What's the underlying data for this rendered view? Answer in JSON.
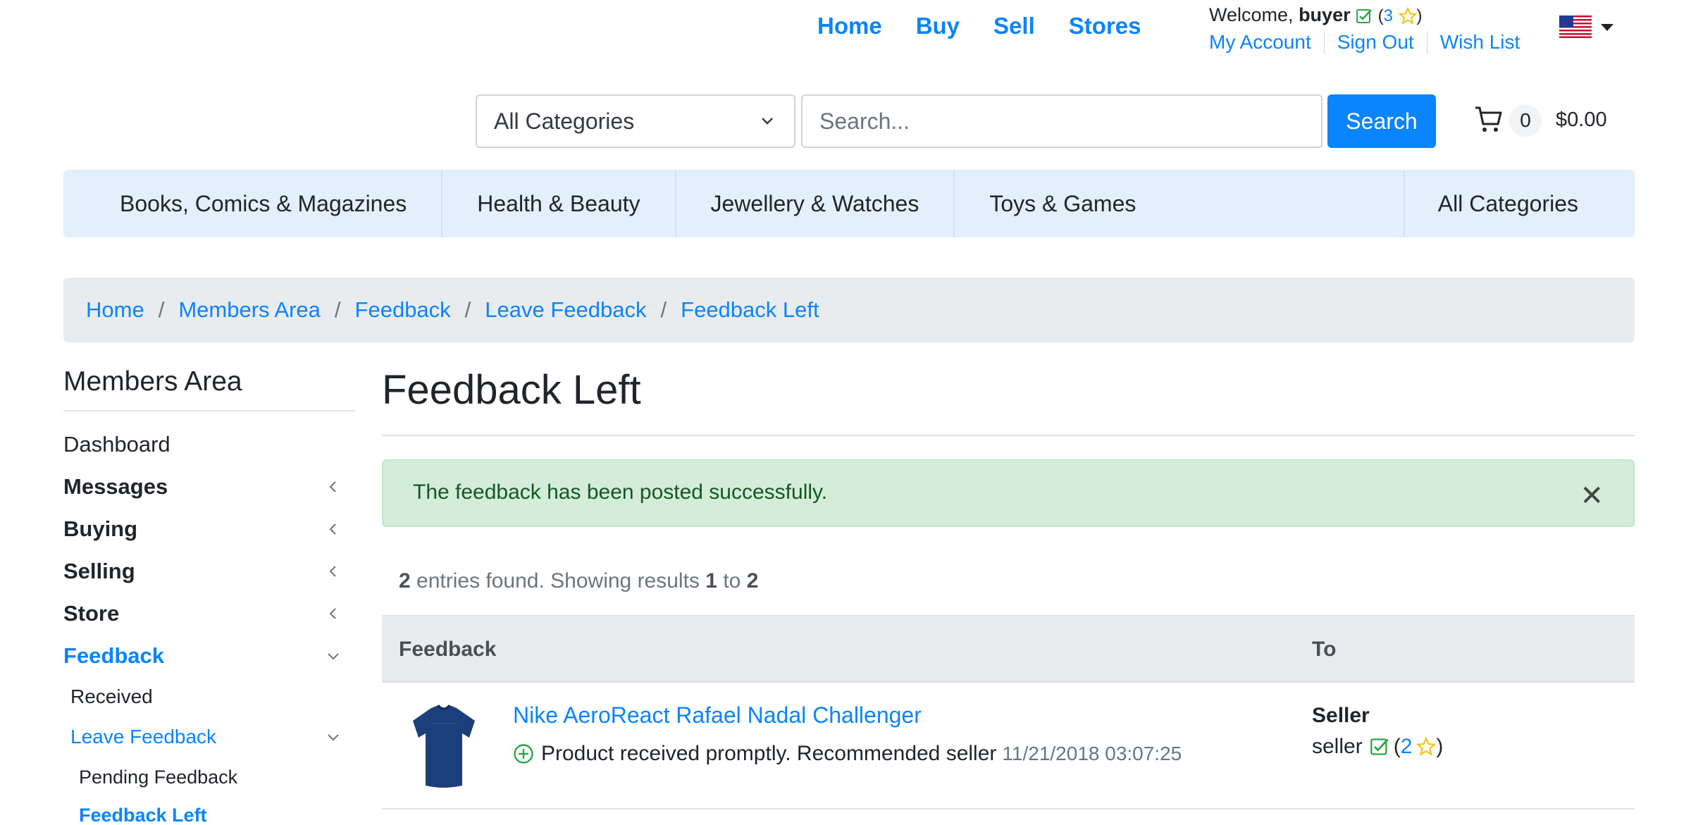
{
  "top_nav": [
    "Home",
    "Buy",
    "Sell",
    "Stores"
  ],
  "user": {
    "welcome": "Welcome,",
    "username": "buyer",
    "rating_open": "(",
    "rating": "3",
    "rating_close": ")",
    "links": [
      "My Account",
      "Sign Out",
      "Wish List"
    ]
  },
  "search": {
    "category": "All Categories",
    "placeholder": "Search...",
    "button": "Search"
  },
  "cart": {
    "count": "0",
    "total": "$0.00"
  },
  "categories": [
    "Books, Comics & Magazines",
    "Health & Beauty",
    "Jewellery & Watches",
    "Toys & Games"
  ],
  "all_categories": "All Categories",
  "breadcrumb": [
    "Home",
    "Members Area",
    "Feedback",
    "Leave Feedback",
    "Feedback Left"
  ],
  "sidebar": {
    "title": "Members Area",
    "dashboard": "Dashboard",
    "messages": "Messages",
    "buying": "Buying",
    "selling": "Selling",
    "store": "Store",
    "feedback": "Feedback",
    "received": "Received",
    "leave_feedback": "Leave Feedback",
    "pending": "Pending Feedback",
    "feedback_left": "Feedback Left"
  },
  "main": {
    "title": "Feedback Left",
    "alert": "The feedback has been posted successfully.",
    "entries_count": "2",
    "entries_text": "entries found. Showing results",
    "from": "1",
    "to_word": "to",
    "to": "2"
  },
  "table": {
    "headers": [
      "Feedback",
      "To"
    ],
    "rows": [
      {
        "item": "Nike AeroReact Rafael Nadal Challenger",
        "comment": "Product received promptly. Recommended seller",
        "date": "11/21/2018 03:07:25",
        "to_role": "Seller",
        "to_user": "seller",
        "to_rating": "2"
      }
    ]
  },
  "colors": {
    "accent": "#0a84ff",
    "success": "#28a745",
    "star": "#f5c518"
  },
  "icons": [
    "verified-check-icon",
    "star-icon",
    "us-flag-icon",
    "cart-icon",
    "chevron-left-icon",
    "chevron-down-icon",
    "close-icon",
    "positive-plus-icon",
    "tshirt-image"
  ]
}
